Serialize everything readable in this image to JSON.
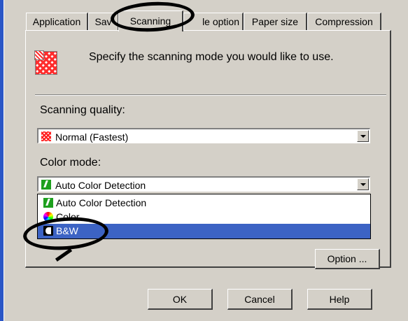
{
  "tabs": [
    "Application",
    "Sav",
    "Scanning",
    "le option",
    "Paper size",
    "Compression"
  ],
  "header": {
    "text": "Specify the scanning mode you would like to use."
  },
  "quality": {
    "label": "Scanning quality:",
    "value": "Normal (Fastest)"
  },
  "color_mode": {
    "label": "Color mode:",
    "value": "Auto Color Detection",
    "options": [
      {
        "label": "Auto Color Detection",
        "icon": "auto-color-icon"
      },
      {
        "label": "Color",
        "icon": "color-wheel-icon"
      },
      {
        "label": "B&W",
        "icon": "bw-icon",
        "selected": true
      }
    ]
  },
  "buttons": {
    "option": "Option ...",
    "ok": "OK",
    "cancel": "Cancel",
    "help": "Help"
  },
  "colors": {
    "selection": "#3c63c4",
    "dialog": "#d4d0c8",
    "accent_bar": "#2a56c6"
  }
}
